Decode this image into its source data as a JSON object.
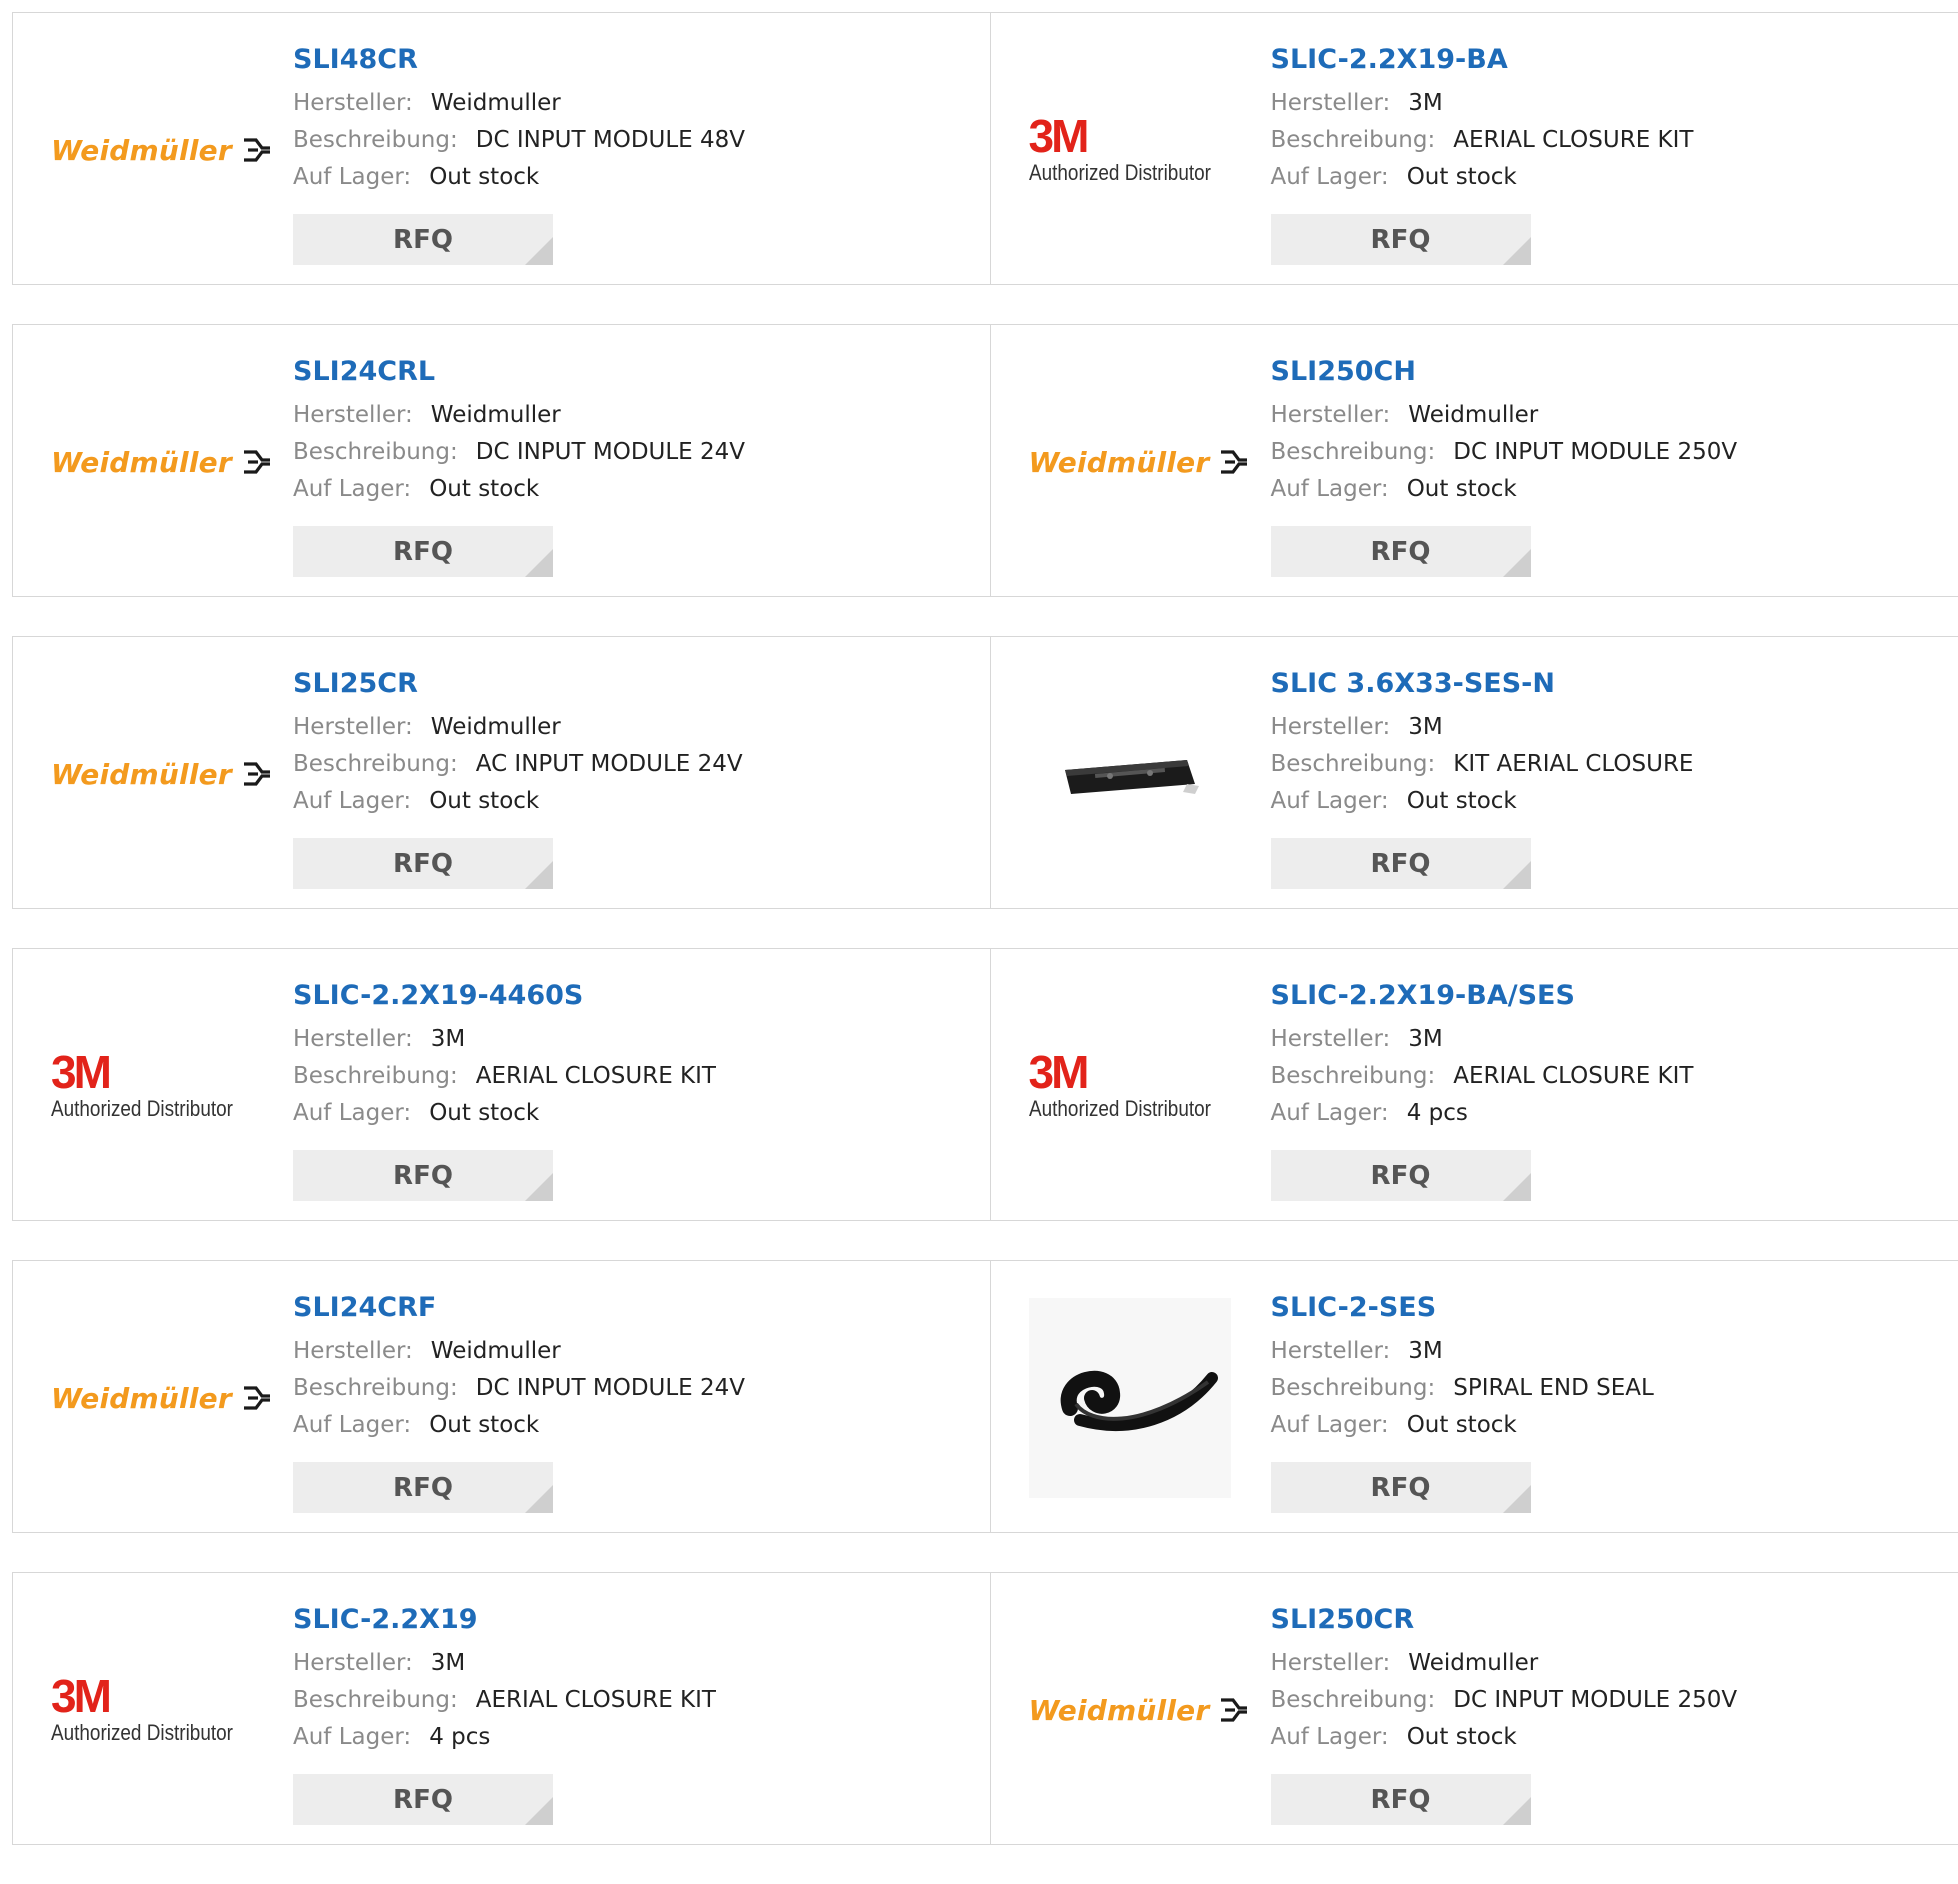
{
  "labels": {
    "manufacturer": "Hersteller:",
    "description": "Beschreibung:",
    "stock": "Auf Lager:",
    "rfq": "RFQ"
  },
  "brand_logos": {
    "weidmuller": "Weidmüller",
    "threem_mark": "3M",
    "threem_sub": "Authorized Distributor"
  },
  "products": [
    {
      "part": "SLI48CR",
      "manufacturer": "Weidmuller",
      "description": "DC INPUT MODULE 48V",
      "stock": "Out stock",
      "logo": "weidmuller"
    },
    {
      "part": "SLIC-2.2X19-BA",
      "manufacturer": "3M",
      "description": "AERIAL CLOSURE KIT",
      "stock": "Out stock",
      "logo": "3m"
    },
    {
      "part": "SLI24CRL",
      "manufacturer": "Weidmuller",
      "description": "DC INPUT MODULE 24V",
      "stock": "Out stock",
      "logo": "weidmuller"
    },
    {
      "part": "SLI250CH",
      "manufacturer": "Weidmuller",
      "description": "DC INPUT MODULE 250V",
      "stock": "Out stock",
      "logo": "weidmuller"
    },
    {
      "part": "SLI25CR",
      "manufacturer": "Weidmuller",
      "description": "AC INPUT MODULE 24V",
      "stock": "Out stock",
      "logo": "weidmuller"
    },
    {
      "part": "SLIC 3.6X33-SES-N",
      "manufacturer": "3M",
      "description": "KIT AERIAL CLOSURE",
      "stock": "Out stock",
      "logo": "closure-photo"
    },
    {
      "part": "SLIC-2.2X19-4460S",
      "manufacturer": "3M",
      "description": "AERIAL CLOSURE KIT",
      "stock": "Out stock",
      "logo": "3m"
    },
    {
      "part": "SLIC-2.2X19-BA/SES",
      "manufacturer": "3M",
      "description": "AERIAL CLOSURE KIT",
      "stock": "4 pcs",
      "logo": "3m"
    },
    {
      "part": "SLI24CRF",
      "manufacturer": "Weidmuller",
      "description": "DC INPUT MODULE 24V",
      "stock": "Out stock",
      "logo": "weidmuller"
    },
    {
      "part": "SLIC-2-SES",
      "manufacturer": "3M",
      "description": "SPIRAL END SEAL",
      "stock": "Out stock",
      "logo": "seal-photo"
    },
    {
      "part": "SLIC-2.2X19",
      "manufacturer": "3M",
      "description": "AERIAL CLOSURE KIT",
      "stock": "4 pcs",
      "logo": "3m"
    },
    {
      "part": "SLI250CR",
      "manufacturer": "Weidmuller",
      "description": "DC INPUT MODULE 250V",
      "stock": "Out stock",
      "logo": "weidmuller"
    }
  ]
}
